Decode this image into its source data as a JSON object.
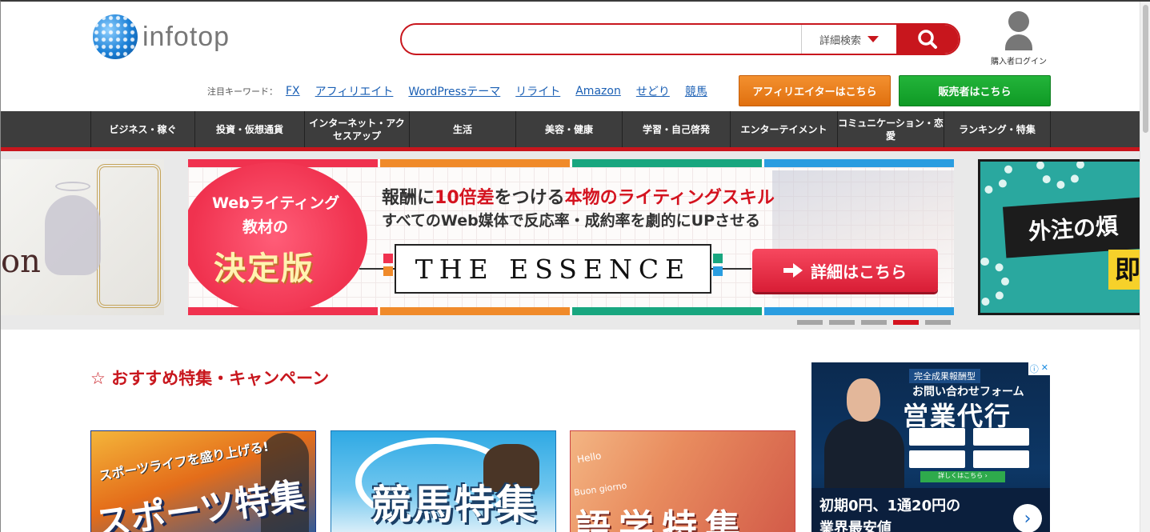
{
  "header": {
    "logo_text": "infotop",
    "search": {
      "placeholder": "",
      "advanced_label": "詳細検索"
    },
    "login_label": "購入者ログイン"
  },
  "keywords": {
    "label": "注目キーワード：",
    "items": [
      "FX",
      "アフィリエイト",
      "WordPressテーマ",
      "リライト",
      "Amazon",
      "せどり",
      "競馬"
    ]
  },
  "cta": {
    "affiliate_label": "アフィリエイターはこちら",
    "seller_label": "販売者はこちら"
  },
  "nav": {
    "items": [
      "ビジネス・稼ぐ",
      "投資・仮想通貨",
      "インターネット・アクセスアップ",
      "生活",
      "美容・健康",
      "学習・自己啓発",
      "エンターテイメント",
      "コミュニケーション・恋愛",
      "ランキング・特集"
    ]
  },
  "slider": {
    "left_text": "on",
    "main": {
      "circle_line1": "Webライティング",
      "circle_line2": "教材の",
      "circle_line3": "決定版",
      "headline_a": "報酬に",
      "headline_b": "10倍差",
      "headline_c": "をつける",
      "headline_d": "本物のライティングスキル",
      "subline": "すべてのWeb媒体で反応率・成約率を劇的にUPさせる",
      "product": "THE ESSENCE",
      "button": "詳細はこちら"
    },
    "right_band": "外注の煩",
    "right_yellow": "即",
    "dots": 5,
    "active_dot": 4
  },
  "featured": {
    "title": "おすすめ特集・キャンペーン",
    "cards": [
      {
        "small": "スポーツライフを盛り上げる!",
        "big": "スポーツ特集"
      },
      {
        "big": "競馬特集"
      },
      {
        "hello": "Hello",
        "buon": "Buon giorno",
        "big": "語学特集"
      }
    ]
  },
  "ad": {
    "tag": "完全成果報酬型",
    "sub": "お問い合わせフォーム",
    "big": "営業代行",
    "mini": "詳しくはこちら ›",
    "line1": "初期0円、1通20円の",
    "line2": "業界最安値"
  },
  "colors": {
    "brand_red": "#c8161d",
    "nav_bg": "#3d3d3d",
    "affiliate_orange": "#e0700f",
    "seller_green": "#0f9a25",
    "link_blue": "#1a5fb4"
  }
}
